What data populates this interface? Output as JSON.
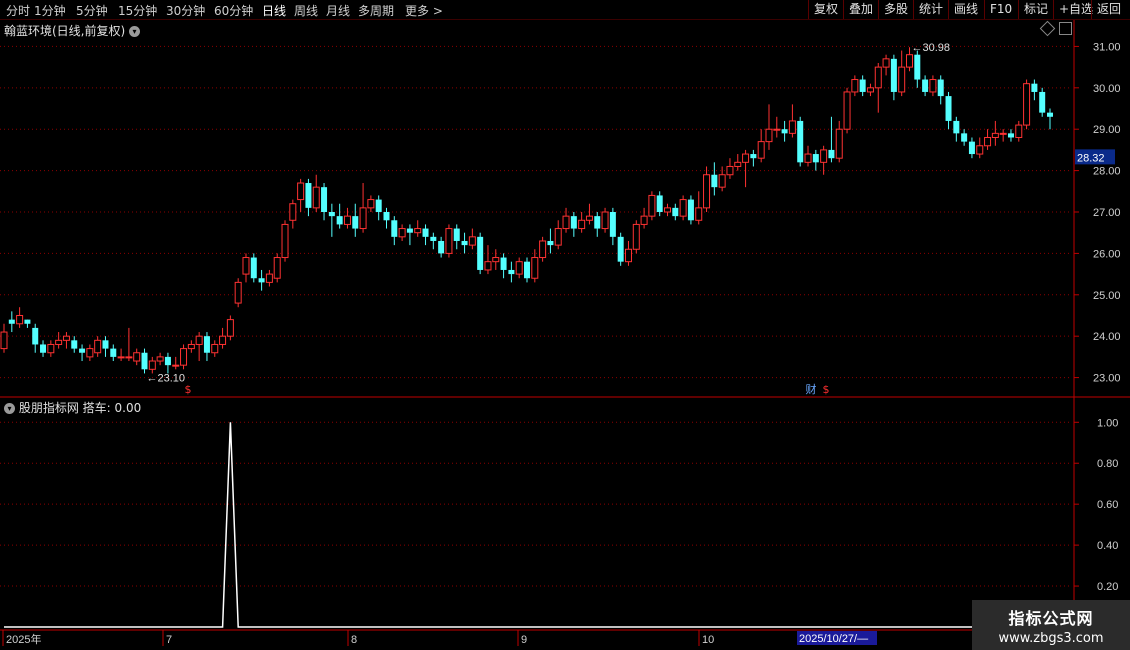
{
  "toolbar": {
    "periods": [
      "分时",
      "1分钟",
      "5分钟",
      "15分钟",
      "30分钟",
      "60分钟",
      "日线",
      "周线",
      "月线",
      "多周期",
      "更多 >"
    ],
    "active_period": "日线",
    "right_buttons": [
      "复权",
      "叠加",
      "多股",
      "统计",
      "画线",
      "F10",
      "标记",
      "+自选",
      "返回"
    ]
  },
  "main_panel": {
    "title": "翰蓝环境(日线,前复权)",
    "current_price": "28.32",
    "high_label": "30.98",
    "low_label": "23.10",
    "event_marks": [
      "$",
      "财",
      "$"
    ]
  },
  "sub_panel": {
    "title": "股朋指标网 搭车: 0.00"
  },
  "date_axis": {
    "labels": [
      "2025年",
      "7",
      "8",
      "9",
      "10"
    ],
    "highlight": "2025/10/27/—"
  },
  "watermark": {
    "title": "指标公式网",
    "url": "www.zbgs3.com"
  },
  "colors": {
    "up": "#ff3232",
    "down": "#54ffff",
    "grid": "#8b0000",
    "axis": "#c00000",
    "price_tag_bg": "#0a2a8a",
    "date_highlight_bg": "#1a1a9a"
  },
  "chart_data": [
    {
      "type": "candlestick",
      "title": "翰蓝环境(日线,前复权)",
      "ylim": [
        22.7,
        31.3
      ],
      "yticks": [
        "23.00",
        "24.00",
        "25.00",
        "26.00",
        "27.00",
        "28.00",
        "29.00",
        "30.00",
        "31.00"
      ],
      "ohlc": [
        [
          23.7,
          24.1,
          23.6,
          24.3
        ],
        [
          24.4,
          24.3,
          24.1,
          24.6
        ],
        [
          24.3,
          24.5,
          24.2,
          24.7
        ],
        [
          24.4,
          24.3,
          24.2,
          24.4
        ],
        [
          24.2,
          23.8,
          23.6,
          24.3
        ],
        [
          23.8,
          23.6,
          23.5,
          23.9
        ],
        [
          23.6,
          23.8,
          23.5,
          23.9
        ],
        [
          23.8,
          23.9,
          23.7,
          24.1
        ],
        [
          23.9,
          24.0,
          23.7,
          24.1
        ],
        [
          23.9,
          23.7,
          23.6,
          24.0
        ],
        [
          23.7,
          23.6,
          23.4,
          23.8
        ],
        [
          23.5,
          23.7,
          23.4,
          23.8
        ],
        [
          23.6,
          23.9,
          23.5,
          24.0
        ],
        [
          23.9,
          23.7,
          23.5,
          24.0
        ],
        [
          23.7,
          23.5,
          23.4,
          23.8
        ],
        [
          23.5,
          23.5,
          23.4,
          23.7
        ],
        [
          23.5,
          23.5,
          23.4,
          24.2
        ],
        [
          23.4,
          23.6,
          23.3,
          23.7
        ],
        [
          23.6,
          23.2,
          23.1,
          23.7
        ],
        [
          23.2,
          23.4,
          23.1,
          23.5
        ],
        [
          23.4,
          23.5,
          23.3,
          23.6
        ],
        [
          23.5,
          23.3,
          23.1,
          23.6
        ],
        [
          23.3,
          23.3,
          23.2,
          23.5
        ],
        [
          23.3,
          23.7,
          23.2,
          23.8
        ],
        [
          23.7,
          23.8,
          23.6,
          23.9
        ],
        [
          23.8,
          24.0,
          23.4,
          24.1
        ],
        [
          24.0,
          23.6,
          23.4,
          24.1
        ],
        [
          23.6,
          23.8,
          23.5,
          23.9
        ],
        [
          23.8,
          24.0,
          23.7,
          24.2
        ],
        [
          24.0,
          24.4,
          23.9,
          24.5
        ],
        [
          24.8,
          25.3,
          24.7,
          25.4
        ],
        [
          25.5,
          25.9,
          25.3,
          26.0
        ],
        [
          25.9,
          25.4,
          25.3,
          26.0
        ],
        [
          25.4,
          25.3,
          25.1,
          25.6
        ],
        [
          25.3,
          25.5,
          25.2,
          25.6
        ],
        [
          25.4,
          25.9,
          25.3,
          26.0
        ],
        [
          25.9,
          26.7,
          25.8,
          26.8
        ],
        [
          26.8,
          27.2,
          26.6,
          27.3
        ],
        [
          27.3,
          27.7,
          27.0,
          27.8
        ],
        [
          27.7,
          27.1,
          26.9,
          27.8
        ],
        [
          27.1,
          27.6,
          27.0,
          27.9
        ],
        [
          27.6,
          27.0,
          26.8,
          27.7
        ],
        [
          27.0,
          26.9,
          26.4,
          27.2
        ],
        [
          26.9,
          26.7,
          26.6,
          27.2
        ],
        [
          26.7,
          26.9,
          26.6,
          27.1
        ],
        [
          26.9,
          26.6,
          26.4,
          27.2
        ],
        [
          26.6,
          27.1,
          26.5,
          27.7
        ],
        [
          27.1,
          27.3,
          27.0,
          27.4
        ],
        [
          27.3,
          27.0,
          26.8,
          27.4
        ],
        [
          27.0,
          26.8,
          26.6,
          27.1
        ],
        [
          26.8,
          26.4,
          26.2,
          26.9
        ],
        [
          26.4,
          26.6,
          26.3,
          26.7
        ],
        [
          26.6,
          26.5,
          26.2,
          26.7
        ],
        [
          26.5,
          26.6,
          26.4,
          26.8
        ],
        [
          26.6,
          26.4,
          26.2,
          26.7
        ],
        [
          26.4,
          26.3,
          26.1,
          26.5
        ],
        [
          26.3,
          26.0,
          25.9,
          26.4
        ],
        [
          26.0,
          26.6,
          25.9,
          26.7
        ],
        [
          26.6,
          26.3,
          26.1,
          26.7
        ],
        [
          26.3,
          26.2,
          26.0,
          26.5
        ],
        [
          26.2,
          26.4,
          26.1,
          26.6
        ],
        [
          26.4,
          25.6,
          25.5,
          26.5
        ],
        [
          25.6,
          25.8,
          25.5,
          26.2
        ],
        [
          25.8,
          25.9,
          25.6,
          26.1
        ],
        [
          25.9,
          25.6,
          25.4,
          26.0
        ],
        [
          25.6,
          25.5,
          25.3,
          25.8
        ],
        [
          25.5,
          25.8,
          25.4,
          25.9
        ],
        [
          25.8,
          25.4,
          25.3,
          25.9
        ],
        [
          25.4,
          25.9,
          25.3,
          26.1
        ],
        [
          25.9,
          26.3,
          25.8,
          26.4
        ],
        [
          26.3,
          26.2,
          26.0,
          26.6
        ],
        [
          26.2,
          26.6,
          26.1,
          26.8
        ],
        [
          26.6,
          26.9,
          26.5,
          27.1
        ],
        [
          26.9,
          26.6,
          26.4,
          27.0
        ],
        [
          26.6,
          26.8,
          26.5,
          27.0
        ],
        [
          26.8,
          26.9,
          26.7,
          27.2
        ],
        [
          26.9,
          26.6,
          26.4,
          27.0
        ],
        [
          26.6,
          27.0,
          26.5,
          27.1
        ],
        [
          27.0,
          26.4,
          26.2,
          27.1
        ],
        [
          26.4,
          25.8,
          25.7,
          26.5
        ],
        [
          25.8,
          26.1,
          25.7,
          26.3
        ],
        [
          26.1,
          26.7,
          26.0,
          26.8
        ],
        [
          26.7,
          26.9,
          26.6,
          27.1
        ],
        [
          26.9,
          27.4,
          26.8,
          27.5
        ],
        [
          27.4,
          27.0,
          26.9,
          27.5
        ],
        [
          27.0,
          27.1,
          26.9,
          27.2
        ],
        [
          27.1,
          26.9,
          26.8,
          27.2
        ],
        [
          26.9,
          27.3,
          26.8,
          27.4
        ],
        [
          27.3,
          26.8,
          26.7,
          27.4
        ],
        [
          26.8,
          27.1,
          26.7,
          27.5
        ],
        [
          27.1,
          27.9,
          27.0,
          28.1
        ],
        [
          27.9,
          27.6,
          27.4,
          28.2
        ],
        [
          27.6,
          27.9,
          27.5,
          28.1
        ],
        [
          27.9,
          28.1,
          27.8,
          28.3
        ],
        [
          28.1,
          28.2,
          28.0,
          28.4
        ],
        [
          28.2,
          28.4,
          27.6,
          28.5
        ],
        [
          28.4,
          28.3,
          28.1,
          28.5
        ],
        [
          28.3,
          28.7,
          28.2,
          29.0
        ],
        [
          28.7,
          29.0,
          28.5,
          29.6
        ],
        [
          29.0,
          29.0,
          28.8,
          29.3
        ],
        [
          29.0,
          28.9,
          28.7,
          29.2
        ],
        [
          28.9,
          29.2,
          28.8,
          29.6
        ],
        [
          29.2,
          28.2,
          28.1,
          29.3
        ],
        [
          28.2,
          28.4,
          28.1,
          28.6
        ],
        [
          28.4,
          28.2,
          28.0,
          28.5
        ],
        [
          28.2,
          28.5,
          27.9,
          28.6
        ],
        [
          28.5,
          28.3,
          28.2,
          29.3
        ],
        [
          28.3,
          29.0,
          28.2,
          29.2
        ],
        [
          29.0,
          29.9,
          28.9,
          30.0
        ],
        [
          29.9,
          30.2,
          29.8,
          30.3
        ],
        [
          30.2,
          29.9,
          29.8,
          30.3
        ],
        [
          29.9,
          30.0,
          29.8,
          30.1
        ],
        [
          30.0,
          30.5,
          29.4,
          30.6
        ],
        [
          30.5,
          30.7,
          30.3,
          30.8
        ],
        [
          30.7,
          29.9,
          29.7,
          30.8
        ],
        [
          29.9,
          30.5,
          29.8,
          30.9
        ],
        [
          30.5,
          30.8,
          30.4,
          30.98
        ],
        [
          30.8,
          30.2,
          30.0,
          30.9
        ],
        [
          30.2,
          29.9,
          29.8,
          30.3
        ],
        [
          29.9,
          30.2,
          29.8,
          30.3
        ],
        [
          30.2,
          29.8,
          29.6,
          30.3
        ],
        [
          29.8,
          29.2,
          29.0,
          29.9
        ],
        [
          29.2,
          28.9,
          28.7,
          29.3
        ],
        [
          28.9,
          28.7,
          28.6,
          29.0
        ],
        [
          28.7,
          28.4,
          28.3,
          28.8
        ],
        [
          28.4,
          28.6,
          28.3,
          28.8
        ],
        [
          28.6,
          28.8,
          28.5,
          29.0
        ],
        [
          28.8,
          28.9,
          28.6,
          29.2
        ],
        [
          28.9,
          28.9,
          28.7,
          29.0
        ],
        [
          28.9,
          28.8,
          28.7,
          29.0
        ],
        [
          28.8,
          29.1,
          28.7,
          29.2
        ],
        [
          29.1,
          30.1,
          29.0,
          30.2
        ],
        [
          30.1,
          29.9,
          29.7,
          30.2
        ],
        [
          29.9,
          29.4,
          29.3,
          30.0
        ],
        [
          29.4,
          29.3,
          29.0,
          29.5
        ]
      ]
    },
    {
      "type": "line",
      "title": "股朋指标网 搭车: 0.00",
      "ylim": [
        0.0,
        1.06
      ],
      "yticks": [
        "0.20",
        "0.40",
        "0.60",
        "0.80",
        "1.00"
      ],
      "series": [
        {
          "name": "搭车",
          "values": [],
          "spike_index": 29,
          "spike_value": 1.0
        }
      ]
    }
  ]
}
